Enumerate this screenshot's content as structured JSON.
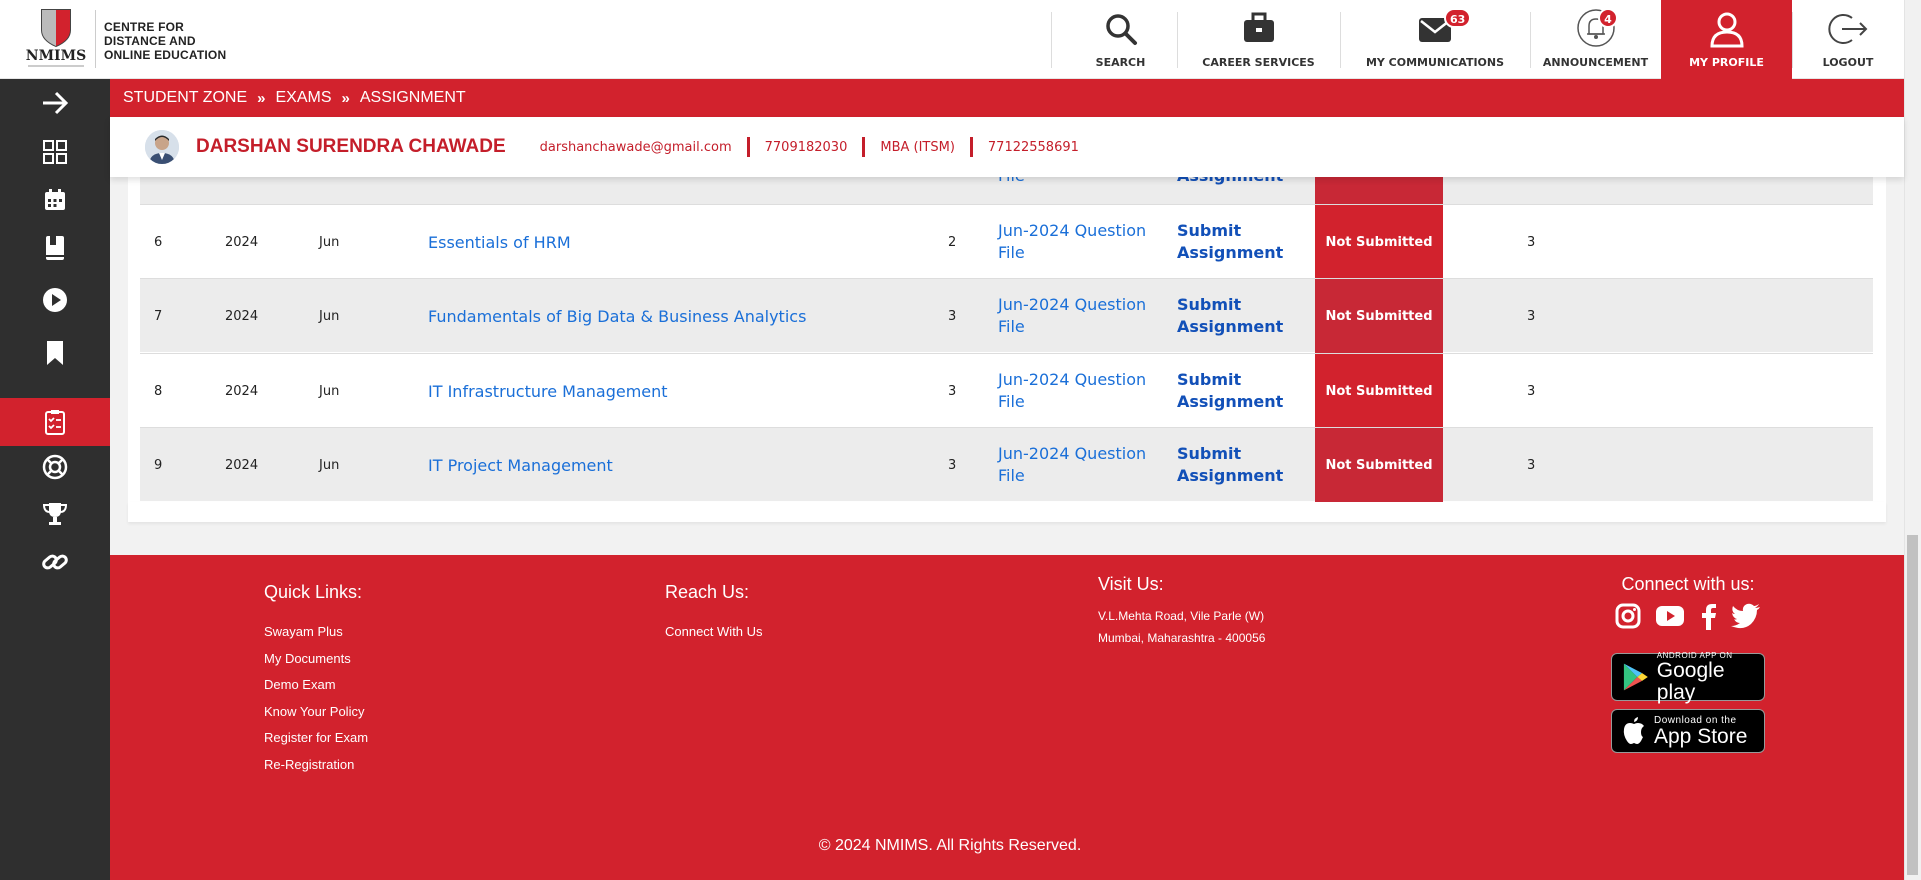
{
  "header": {
    "logo_text": [
      "CENTRE FOR",
      "DISTANCE AND",
      "ONLINE EDUCATION"
    ],
    "logo_mark": "NMIMS",
    "nav": [
      {
        "label": "SEARCH",
        "icon": "search-icon"
      },
      {
        "label": "CAREER SERVICES",
        "icon": "briefcase-icon"
      },
      {
        "label": "MY COMMUNICATIONS",
        "icon": "mail-icon",
        "badge": "63"
      },
      {
        "label": "ANNOUNCEMENT",
        "icon": "bell-icon",
        "badge": "4"
      },
      {
        "label": "MY PROFILE",
        "icon": "user-icon",
        "active": true
      },
      {
        "label": "LOGOUT",
        "icon": "logout-icon"
      }
    ]
  },
  "breadcrumb": [
    "STUDENT ZONE",
    "EXAMS",
    "ASSIGNMENT"
  ],
  "student": {
    "name": "DARSHAN SURENDRA CHAWADE",
    "email": "darshanchawade@gmail.com",
    "phone": "7709182030",
    "program": "MBA (ITSM)",
    "sap_id": "77122558691"
  },
  "partial_row": {
    "question": "File",
    "submit": "Assignment"
  },
  "rows": [
    {
      "sr": "6",
      "year": "2024",
      "month": "Jun",
      "subject": "Essentials of HRM",
      "sem": "2",
      "question": "Jun-2024 Question File",
      "submit": "Submit Assignment",
      "status": "Not Submitted",
      "attempts": "3"
    },
    {
      "sr": "7",
      "year": "2024",
      "month": "Jun",
      "subject": "Fundamentals of Big Data & Business Analytics",
      "sem": "3",
      "question": "Jun-2024 Question File",
      "submit": "Submit Assignment",
      "status": "Not Submitted",
      "attempts": "3"
    },
    {
      "sr": "8",
      "year": "2024",
      "month": "Jun",
      "subject": "IT Infrastructure Management",
      "sem": "3",
      "question": "Jun-2024 Question File",
      "submit": "Submit Assignment",
      "status": "Not Submitted",
      "attempts": "3"
    },
    {
      "sr": "9",
      "year": "2024",
      "month": "Jun",
      "subject": "IT Project Management",
      "sem": "3",
      "question": "Jun-2024 Question File",
      "submit": "Submit Assignment",
      "status": "Not Submitted",
      "attempts": "3"
    }
  ],
  "footer": {
    "quick_links_title": "Quick Links:",
    "quick_links": [
      "Swayam Plus",
      "My Documents",
      "Demo Exam",
      "Know Your Policy",
      "Register for Exam",
      "Re-Registration"
    ],
    "reach_title": "Reach Us:",
    "reach_links": [
      "Connect With Us"
    ],
    "visit_title": "Visit Us:",
    "address": [
      "V.L.Mehta Road, Vile Parle (W)",
      "Mumbai, Maharashtra - 400056"
    ],
    "connect_title": "Connect with us:",
    "google_play": {
      "small": "ANDROID APP ON",
      "big": "Google play"
    },
    "app_store": {
      "small": "Download on the",
      "big": "App Store"
    },
    "copyright": "© 2024 NMIMS. All Rights Reserved."
  },
  "colors": {
    "brand_red": "#d2222d",
    "sidebar": "#2f2f2f",
    "link_blue": "#1a6fd8"
  }
}
